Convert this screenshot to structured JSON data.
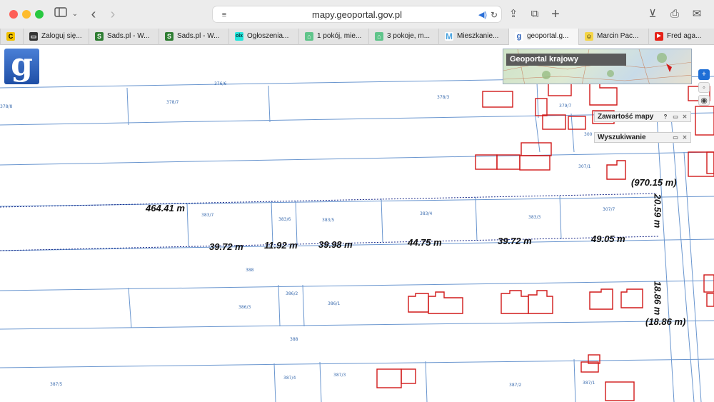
{
  "browser": {
    "url": "mapy.geoportal.gov.pl",
    "tabs": [
      {
        "label": "",
        "icon": "c-icon",
        "active": false
      },
      {
        "label": "Zaloguj się...",
        "icon": "card-icon",
        "active": false
      },
      {
        "label": "Sads.pl - W...",
        "icon": "sads-icon",
        "active": false
      },
      {
        "label": "Sads.pl - W...",
        "icon": "sads-icon",
        "active": false
      },
      {
        "label": "Ogłoszenia...",
        "icon": "olx-icon",
        "active": false
      },
      {
        "label": "1 pokój, mie...",
        "icon": "otodom-icon",
        "active": false
      },
      {
        "label": "3 pokoje, m...",
        "icon": "otodom-icon",
        "active": false
      },
      {
        "label": "Mieszkanie...",
        "icon": "m-icon",
        "active": false
      },
      {
        "label": "geoportal.g...",
        "icon": "geoportal-icon",
        "active": true
      },
      {
        "label": "Marcin Pac...",
        "icon": "face-icon",
        "active": false
      },
      {
        "label": "Fred aga...",
        "icon": "youtube-icon",
        "active": false
      }
    ]
  },
  "map": {
    "logo_letter": "g",
    "minimap_title": "Geoportal krajowy",
    "panels": {
      "contents_title": "Zawartość mapy",
      "help_label": "?",
      "search_title": "Wyszukiwanie"
    },
    "controls": {
      "zoom_in": "+",
      "toggle": "◦",
      "visibility": "◉"
    },
    "measurements": [
      "464.41 m",
      "39.72 m",
      "11.92 m",
      "39.98 m",
      "44.75 m",
      "39.72 m",
      "49.05 m",
      "(970.15 m)",
      "20.59 m",
      "18.86 m",
      "(18.86 m)"
    ],
    "parcel_labels": [
      "376/6",
      "378/8",
      "378/7",
      "378/3",
      "379/7",
      "300",
      "307/1",
      "383/7",
      "383/6",
      "383/5",
      "383/4",
      "383/3",
      "307/7",
      "388",
      "386/3",
      "386/2",
      "386/1",
      "388",
      "387/5",
      "387/4",
      "387/3",
      "387/2",
      "387/1"
    ]
  },
  "colors": {
    "parcel_line": "#6a96cf",
    "building_outline": "#d11a1a",
    "measure_line": "#1b2b8a"
  }
}
